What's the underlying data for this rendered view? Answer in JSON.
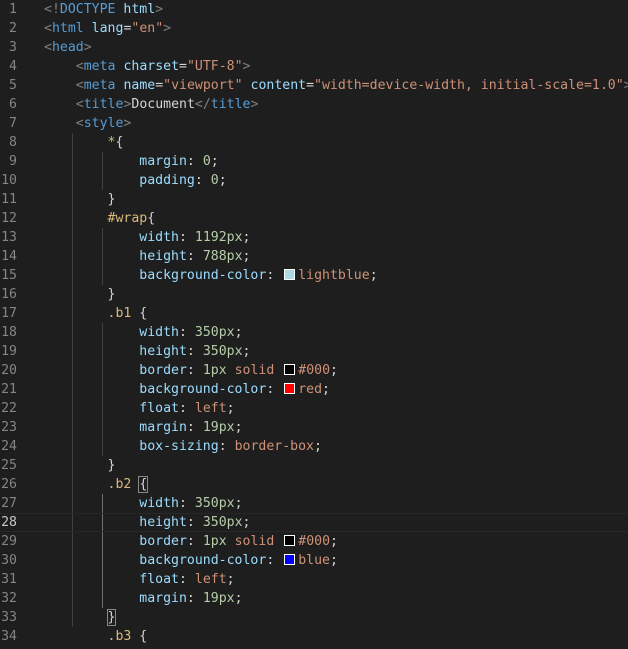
{
  "editor": {
    "lines": [
      {
        "n": "1",
        "tokens": [
          {
            "t": "<!",
            "c": "punc"
          },
          {
            "t": "DOCTYPE",
            "c": "tag"
          },
          {
            "t": " html",
            "c": "attr"
          },
          {
            "t": ">",
            "c": "punc"
          }
        ]
      },
      {
        "n": "2",
        "tokens": [
          {
            "t": "<",
            "c": "punc"
          },
          {
            "t": "html",
            "c": "tag"
          },
          {
            "t": " ",
            "c": "text"
          },
          {
            "t": "lang",
            "c": "attr"
          },
          {
            "t": "=",
            "c": "text"
          },
          {
            "t": "\"en\"",
            "c": "str"
          },
          {
            "t": ">",
            "c": "punc"
          }
        ]
      },
      {
        "n": "3",
        "tokens": [
          {
            "t": "<",
            "c": "punc"
          },
          {
            "t": "head",
            "c": "tag"
          },
          {
            "t": ">",
            "c": "punc"
          }
        ]
      },
      {
        "n": "4",
        "tokens": [
          {
            "t": "    ",
            "c": "text"
          },
          {
            "t": "<",
            "c": "punc"
          },
          {
            "t": "meta",
            "c": "tag"
          },
          {
            "t": " ",
            "c": "text"
          },
          {
            "t": "charset",
            "c": "attr"
          },
          {
            "t": "=",
            "c": "text"
          },
          {
            "t": "\"UTF-8\"",
            "c": "str"
          },
          {
            "t": ">",
            "c": "punc"
          }
        ]
      },
      {
        "n": "5",
        "tokens": [
          {
            "t": "    ",
            "c": "text"
          },
          {
            "t": "<",
            "c": "punc"
          },
          {
            "t": "meta",
            "c": "tag"
          },
          {
            "t": " ",
            "c": "text"
          },
          {
            "t": "name",
            "c": "attr"
          },
          {
            "t": "=",
            "c": "text"
          },
          {
            "t": "\"viewport\"",
            "c": "str"
          },
          {
            "t": " ",
            "c": "text"
          },
          {
            "t": "content",
            "c": "attr"
          },
          {
            "t": "=",
            "c": "text"
          },
          {
            "t": "\"width=device-width, initial-scale=1.0\"",
            "c": "str"
          },
          {
            "t": ">",
            "c": "punc"
          }
        ]
      },
      {
        "n": "6",
        "tokens": [
          {
            "t": "    ",
            "c": "text"
          },
          {
            "t": "<",
            "c": "punc"
          },
          {
            "t": "title",
            "c": "tag"
          },
          {
            "t": ">",
            "c": "punc"
          },
          {
            "t": "Document",
            "c": "text"
          },
          {
            "t": "</",
            "c": "punc"
          },
          {
            "t": "title",
            "c": "tag"
          },
          {
            "t": ">",
            "c": "punc"
          }
        ]
      },
      {
        "n": "7",
        "tokens": [
          {
            "t": "    ",
            "c": "text"
          },
          {
            "t": "<",
            "c": "punc"
          },
          {
            "t": "style",
            "c": "tag"
          },
          {
            "t": ">",
            "c": "punc"
          }
        ]
      },
      {
        "n": "8",
        "tokens": [
          {
            "t": "        ",
            "c": "text"
          },
          {
            "t": "*",
            "c": "sel"
          },
          {
            "t": "{",
            "c": "text"
          }
        ]
      },
      {
        "n": "9",
        "tokens": [
          {
            "t": "            ",
            "c": "text"
          },
          {
            "t": "margin",
            "c": "prop"
          },
          {
            "t": ": ",
            "c": "text"
          },
          {
            "t": "0",
            "c": "num"
          },
          {
            "t": ";",
            "c": "text"
          }
        ]
      },
      {
        "n": "10",
        "tokens": [
          {
            "t": "            ",
            "c": "text"
          },
          {
            "t": "padding",
            "c": "prop"
          },
          {
            "t": ": ",
            "c": "text"
          },
          {
            "t": "0",
            "c": "num"
          },
          {
            "t": ";",
            "c": "text"
          }
        ]
      },
      {
        "n": "11",
        "tokens": [
          {
            "t": "        ",
            "c": "text"
          },
          {
            "t": "}",
            "c": "text"
          }
        ]
      },
      {
        "n": "12",
        "tokens": [
          {
            "t": "        ",
            "c": "text"
          },
          {
            "t": "#wrap",
            "c": "sel"
          },
          {
            "t": "{",
            "c": "text"
          }
        ]
      },
      {
        "n": "13",
        "tokens": [
          {
            "t": "            ",
            "c": "text"
          },
          {
            "t": "width",
            "c": "prop"
          },
          {
            "t": ": ",
            "c": "text"
          },
          {
            "t": "1192px",
            "c": "num"
          },
          {
            "t": ";",
            "c": "text"
          }
        ]
      },
      {
        "n": "14",
        "tokens": [
          {
            "t": "            ",
            "c": "text"
          },
          {
            "t": "height",
            "c": "prop"
          },
          {
            "t": ": ",
            "c": "text"
          },
          {
            "t": "788px",
            "c": "num"
          },
          {
            "t": ";",
            "c": "text"
          }
        ]
      },
      {
        "n": "15",
        "tokens": [
          {
            "t": "            ",
            "c": "text"
          },
          {
            "t": "background-color",
            "c": "prop"
          },
          {
            "t": ": ",
            "c": "text"
          },
          {
            "t": "",
            "c": "swatch",
            "color": "#add8e6"
          },
          {
            "t": "lightblue",
            "c": "kw"
          },
          {
            "t": ";",
            "c": "text"
          }
        ]
      },
      {
        "n": "16",
        "tokens": [
          {
            "t": "        ",
            "c": "text"
          },
          {
            "t": "}",
            "c": "text"
          }
        ]
      },
      {
        "n": "17",
        "tokens": [
          {
            "t": "        ",
            "c": "text"
          },
          {
            "t": ".b1",
            "c": "sel"
          },
          {
            "t": " {",
            "c": "text"
          }
        ]
      },
      {
        "n": "18",
        "tokens": [
          {
            "t": "            ",
            "c": "text"
          },
          {
            "t": "width",
            "c": "prop"
          },
          {
            "t": ": ",
            "c": "text"
          },
          {
            "t": "350px",
            "c": "num"
          },
          {
            "t": ";",
            "c": "text"
          }
        ]
      },
      {
        "n": "19",
        "tokens": [
          {
            "t": "            ",
            "c": "text"
          },
          {
            "t": "height",
            "c": "prop"
          },
          {
            "t": ": ",
            "c": "text"
          },
          {
            "t": "350px",
            "c": "num"
          },
          {
            "t": ";",
            "c": "text"
          }
        ]
      },
      {
        "n": "20",
        "tokens": [
          {
            "t": "            ",
            "c": "text"
          },
          {
            "t": "border",
            "c": "prop"
          },
          {
            "t": ": ",
            "c": "text"
          },
          {
            "t": "1px",
            "c": "num"
          },
          {
            "t": " ",
            "c": "text"
          },
          {
            "t": "solid",
            "c": "kw"
          },
          {
            "t": " ",
            "c": "text"
          },
          {
            "t": "",
            "c": "swatch",
            "color": "#000000"
          },
          {
            "t": "#000",
            "c": "kw"
          },
          {
            "t": ";",
            "c": "text"
          }
        ]
      },
      {
        "n": "21",
        "tokens": [
          {
            "t": "            ",
            "c": "text"
          },
          {
            "t": "background-color",
            "c": "prop"
          },
          {
            "t": ": ",
            "c": "text"
          },
          {
            "t": "",
            "c": "swatch",
            "color": "#ff0000"
          },
          {
            "t": "red",
            "c": "kw"
          },
          {
            "t": ";",
            "c": "text"
          }
        ]
      },
      {
        "n": "22",
        "tokens": [
          {
            "t": "            ",
            "c": "text"
          },
          {
            "t": "float",
            "c": "prop"
          },
          {
            "t": ": ",
            "c": "text"
          },
          {
            "t": "left",
            "c": "kw"
          },
          {
            "t": ";",
            "c": "text"
          }
        ]
      },
      {
        "n": "23",
        "tokens": [
          {
            "t": "            ",
            "c": "text"
          },
          {
            "t": "margin",
            "c": "prop"
          },
          {
            "t": ": ",
            "c": "text"
          },
          {
            "t": "19px",
            "c": "num"
          },
          {
            "t": ";",
            "c": "text"
          }
        ]
      },
      {
        "n": "24",
        "tokens": [
          {
            "t": "            ",
            "c": "text"
          },
          {
            "t": "box-sizing",
            "c": "prop"
          },
          {
            "t": ": ",
            "c": "text"
          },
          {
            "t": "border-box",
            "c": "kw"
          },
          {
            "t": ";",
            "c": "text"
          }
        ]
      },
      {
        "n": "25",
        "tokens": [
          {
            "t": "        ",
            "c": "text"
          },
          {
            "t": "}",
            "c": "text"
          }
        ]
      },
      {
        "n": "26",
        "tokens": [
          {
            "t": "        ",
            "c": "text"
          },
          {
            "t": ".b2",
            "c": "sel"
          },
          {
            "t": " ",
            "c": "text"
          },
          {
            "t": "{",
            "c": "bracket"
          }
        ]
      },
      {
        "n": "27",
        "tokens": [
          {
            "t": "            ",
            "c": "text"
          },
          {
            "t": "width",
            "c": "prop"
          },
          {
            "t": ": ",
            "c": "text"
          },
          {
            "t": "350px",
            "c": "num"
          },
          {
            "t": ";",
            "c": "text"
          }
        ]
      },
      {
        "n": "28",
        "current": true,
        "tokens": [
          {
            "t": "            ",
            "c": "text"
          },
          {
            "t": "height",
            "c": "prop"
          },
          {
            "t": ": ",
            "c": "text"
          },
          {
            "t": "350px",
            "c": "num"
          },
          {
            "t": ";",
            "c": "text"
          }
        ]
      },
      {
        "n": "29",
        "tokens": [
          {
            "t": "            ",
            "c": "text"
          },
          {
            "t": "border",
            "c": "prop"
          },
          {
            "t": ": ",
            "c": "text"
          },
          {
            "t": "1px",
            "c": "num"
          },
          {
            "t": " ",
            "c": "text"
          },
          {
            "t": "solid",
            "c": "kw"
          },
          {
            "t": " ",
            "c": "text"
          },
          {
            "t": "",
            "c": "swatch",
            "color": "#000000"
          },
          {
            "t": "#000",
            "c": "kw"
          },
          {
            "t": ";",
            "c": "text"
          }
        ]
      },
      {
        "n": "30",
        "tokens": [
          {
            "t": "            ",
            "c": "text"
          },
          {
            "t": "background-color",
            "c": "prop"
          },
          {
            "t": ": ",
            "c": "text"
          },
          {
            "t": "",
            "c": "swatch",
            "color": "#0000ff"
          },
          {
            "t": "blue",
            "c": "kw"
          },
          {
            "t": ";",
            "c": "text"
          }
        ]
      },
      {
        "n": "31",
        "tokens": [
          {
            "t": "            ",
            "c": "text"
          },
          {
            "t": "float",
            "c": "prop"
          },
          {
            "t": ": ",
            "c": "text"
          },
          {
            "t": "left",
            "c": "kw"
          },
          {
            "t": ";",
            "c": "text"
          }
        ]
      },
      {
        "n": "32",
        "tokens": [
          {
            "t": "            ",
            "c": "text"
          },
          {
            "t": "margin",
            "c": "prop"
          },
          {
            "t": ": ",
            "c": "text"
          },
          {
            "t": "19px",
            "c": "num"
          },
          {
            "t": ";",
            "c": "text"
          }
        ]
      },
      {
        "n": "33",
        "tokens": [
          {
            "t": "        ",
            "c": "text"
          },
          {
            "t": "}",
            "c": "bracket"
          }
        ]
      },
      {
        "n": "34",
        "tokens": [
          {
            "t": "        ",
            "c": "text"
          },
          {
            "t": ".b3",
            "c": "sel"
          },
          {
            "t": " {",
            "c": "text"
          }
        ]
      }
    ]
  }
}
